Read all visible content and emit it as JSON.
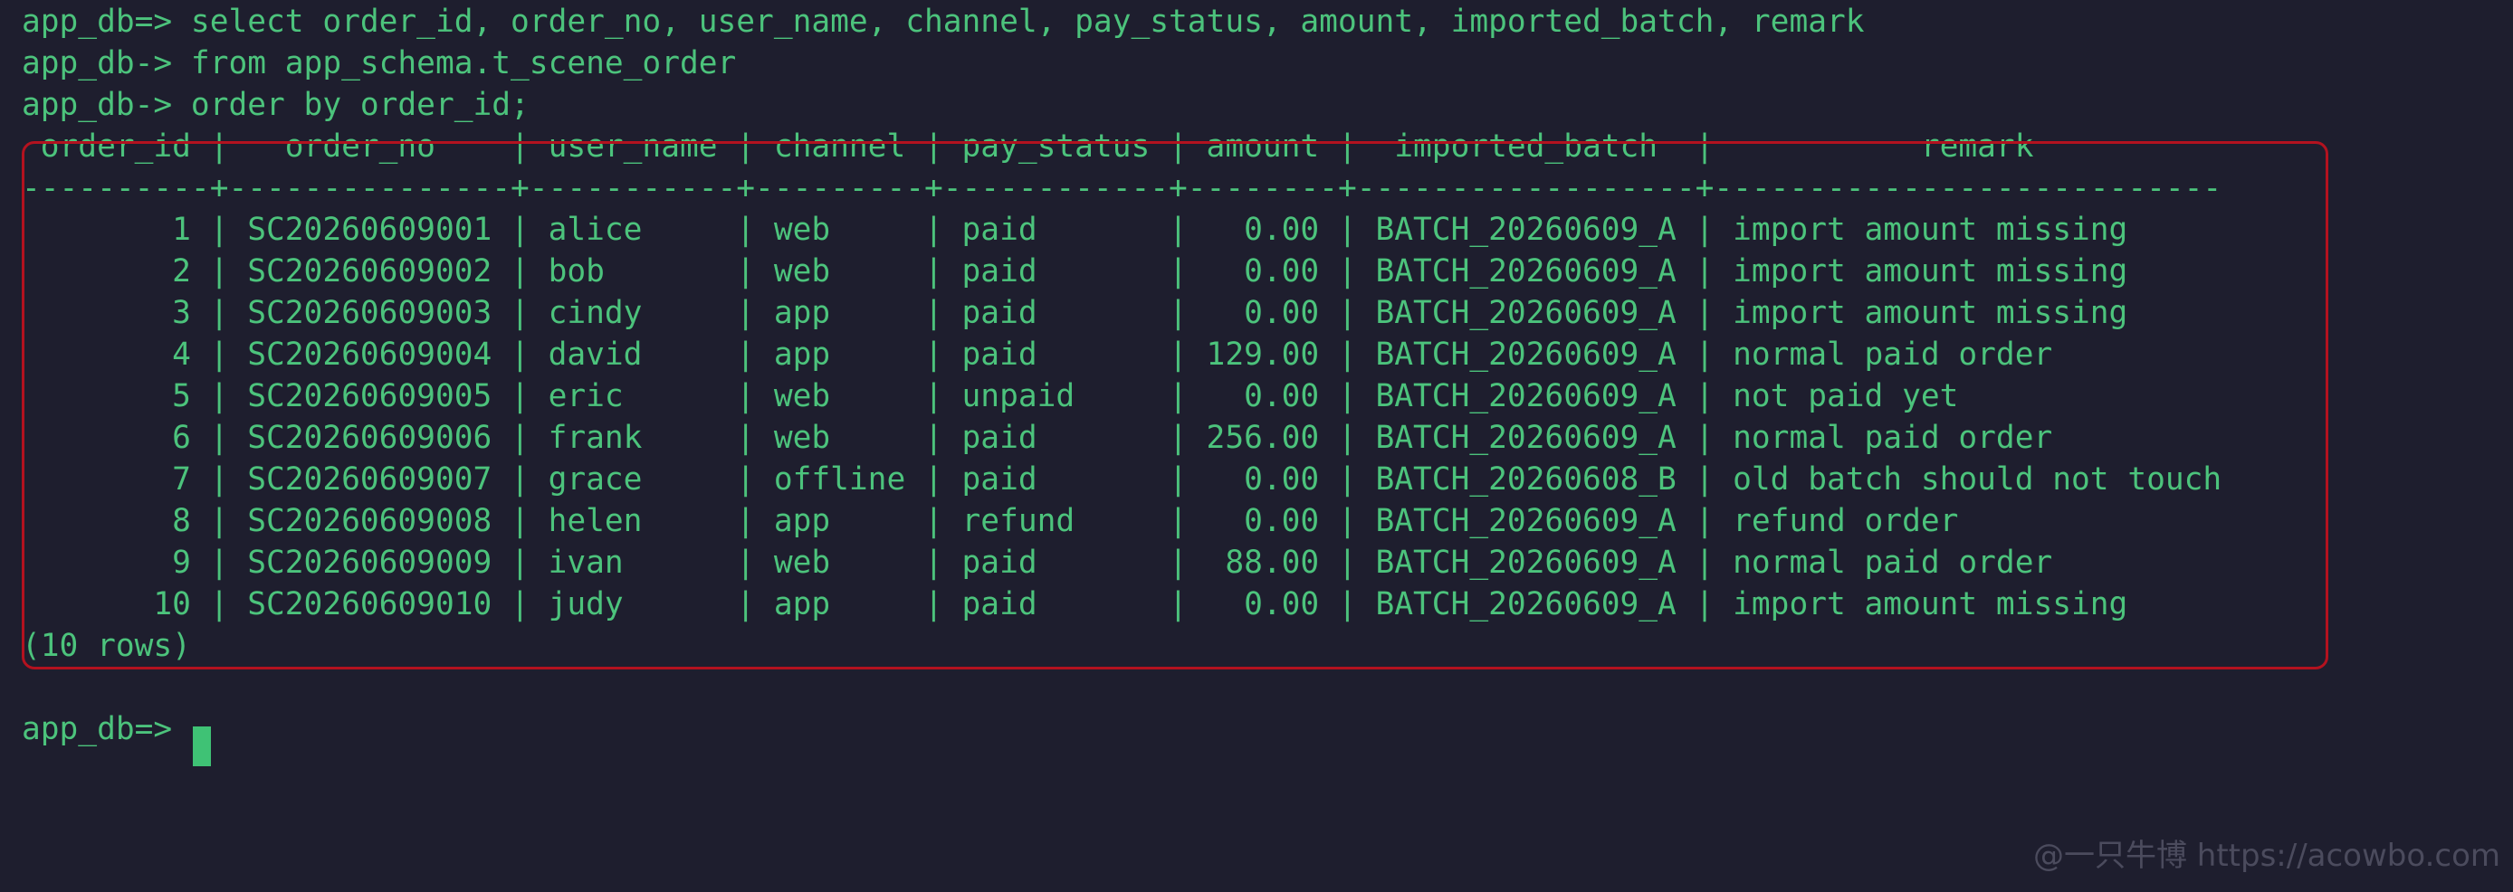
{
  "terminal": {
    "lines": [
      "app_db=> select order_id, order_no, user_name, channel, pay_status, amount, imported_batch, remark",
      "app_db-> from app_schema.t_scene_order",
      "app_db-> order by order_id;",
      " order_id |   order_no    | user_name | channel | pay_status | amount |  imported_batch  |           remark",
      "----------+---------------+-----------+---------+------------+--------+------------------+---------------------------",
      "        1 | SC20260609001 | alice     | web     | paid       |   0.00 | BATCH_20260609_A | import amount missing",
      "        2 | SC20260609002 | bob       | web     | paid       |   0.00 | BATCH_20260609_A | import amount missing",
      "        3 | SC20260609003 | cindy     | app     | paid       |   0.00 | BATCH_20260609_A | import amount missing",
      "        4 | SC20260609004 | david     | app     | paid       | 129.00 | BATCH_20260609_A | normal paid order",
      "        5 | SC20260609005 | eric      | web     | unpaid     |   0.00 | BATCH_20260609_A | not paid yet",
      "        6 | SC20260609006 | frank     | web     | paid       | 256.00 | BATCH_20260609_A | normal paid order",
      "        7 | SC20260609007 | grace     | offline | paid       |   0.00 | BATCH_20260608_B | old batch should not touch",
      "        8 | SC20260609008 | helen     | app     | refund     |   0.00 | BATCH_20260609_A | refund order",
      "        9 | SC20260609009 | ivan      | web     | paid       |  88.00 | BATCH_20260609_A | normal paid order",
      "       10 | SC20260609010 | judy      | app     | paid       |   0.00 | BATCH_20260609_A | import amount missing",
      "(10 rows)",
      "",
      "app_db=> "
    ]
  },
  "watermark": "@一只牛博 https://acowbo.com",
  "colors": {
    "background": "#1e1e2e",
    "text": "#4cc37c",
    "highlight_border": "#b3121f",
    "cursor": "#3fc275",
    "watermark": "#4b4b5d"
  }
}
